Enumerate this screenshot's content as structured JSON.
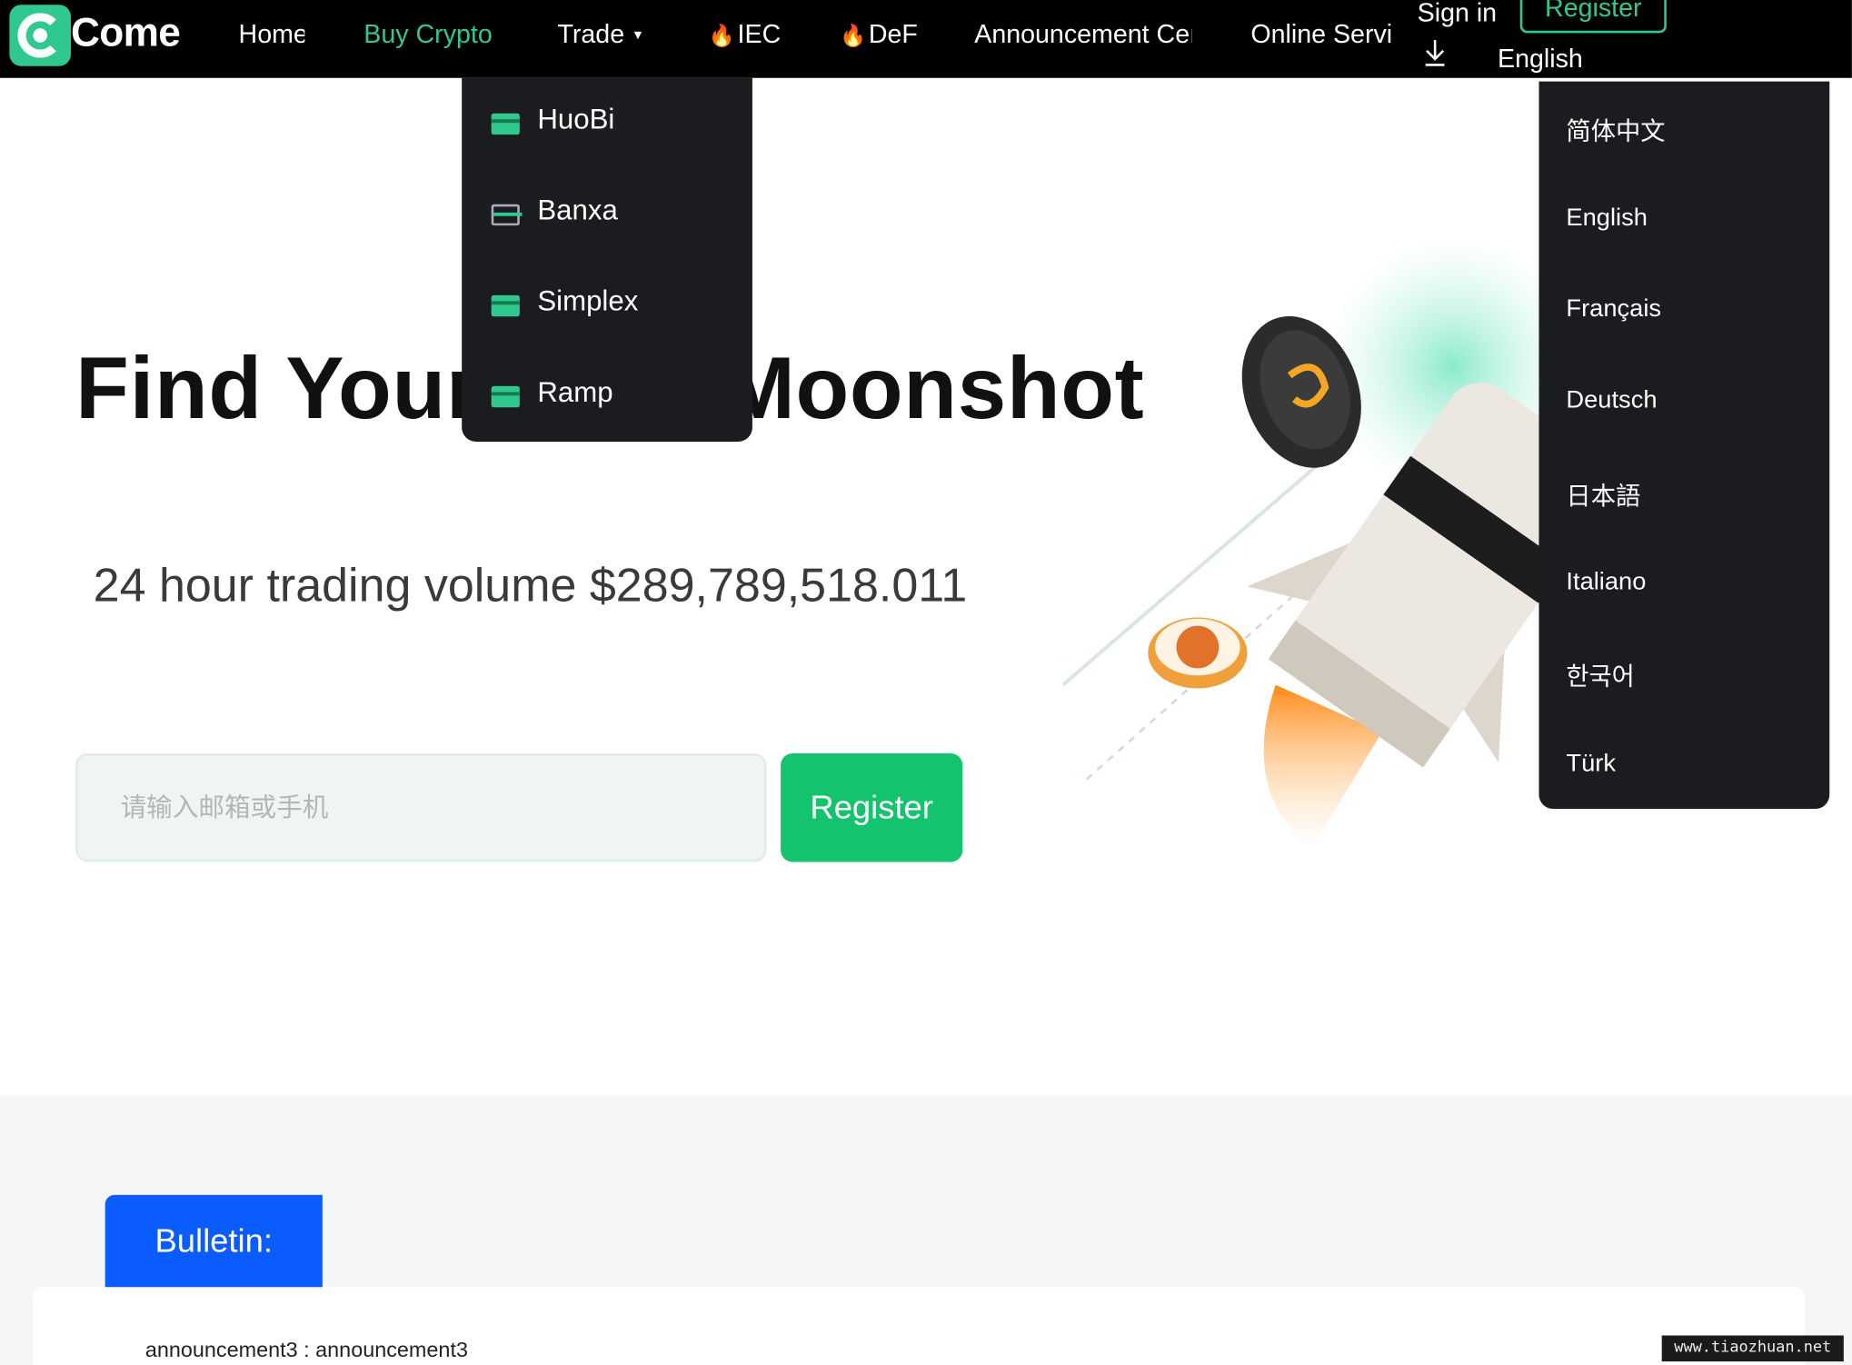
{
  "brand": {
    "logo_text": "Come"
  },
  "nav": {
    "home": "Home",
    "buy_crypto": "Buy Crypto",
    "trade": "Trade",
    "iec": "IEC",
    "def": "DeF",
    "announcement": "Announcement Cer",
    "online_service": "Online Servi",
    "sign_in": "Sign in",
    "register": "Register",
    "language": "English"
  },
  "hero": {
    "title": "Find Your Next Moonshot",
    "volume_label": "24 hour trading volume",
    "volume_value": "$289,789,518.011",
    "input_placeholder": "请输入邮箱或手机",
    "register_button": "Register"
  },
  "buy_menu": {
    "items": [
      {
        "label": "HuoBi"
      },
      {
        "label": "Banxa"
      },
      {
        "label": "Simplex"
      },
      {
        "label": "Ramp"
      }
    ]
  },
  "language_menu": {
    "items": [
      {
        "label": "简体中文"
      },
      {
        "label": "English"
      },
      {
        "label": "Français"
      },
      {
        "label": "Deutsch"
      },
      {
        "label": "日本語"
      },
      {
        "label": "Italiano"
      },
      {
        "label": "한국어"
      },
      {
        "label": "Türk"
      }
    ]
  },
  "bulletin": {
    "label": "Bulletin:",
    "text": "announcement3 : announcement3"
  },
  "watermark": "www.tiaozhuan.net",
  "colors": {
    "accent": "#2fc88e",
    "register_button": "#13c36e",
    "bulletin": "#0a5cff",
    "nav_bg": "#000000",
    "menu_bg": "#1b1c1f"
  }
}
